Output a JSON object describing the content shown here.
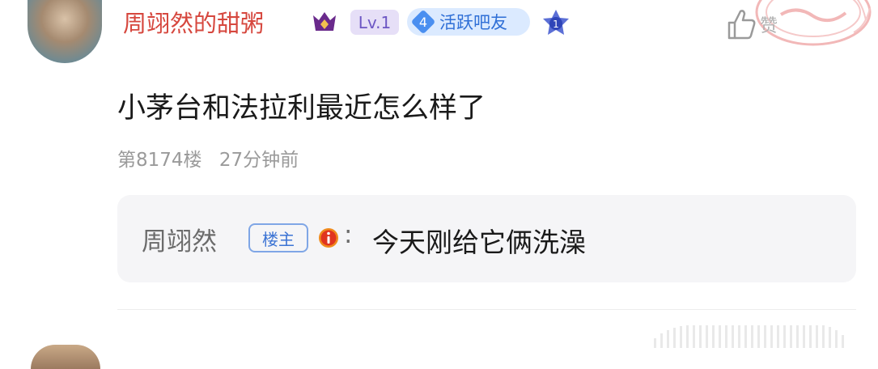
{
  "post": {
    "username": "周翊然的甜粥",
    "level_badge": "Lv.1",
    "active_badge": {
      "number": "4",
      "label": "活跃吧友"
    },
    "level_icon_number": "1",
    "like_label": "赞",
    "text": "小茅台和法拉利最近怎么样了",
    "floor": "第8174楼",
    "time": "27分钟前"
  },
  "reply": {
    "name": "周翊然",
    "owner_tag": "楼主",
    "colon": ":",
    "text": "今天刚给它俩洗澡"
  },
  "colors": {
    "username": "#d6473e",
    "level_badge_bg": "#e6dff7",
    "active_badge_bg": "#dbeaff",
    "owner_tag": "#3c74d4",
    "reply_bg": "#f5f5f7"
  },
  "icons": [
    "avatar",
    "crown-icon",
    "level-star-icon",
    "thumbs-up-icon",
    "info-icon",
    "stamp-icon"
  ]
}
